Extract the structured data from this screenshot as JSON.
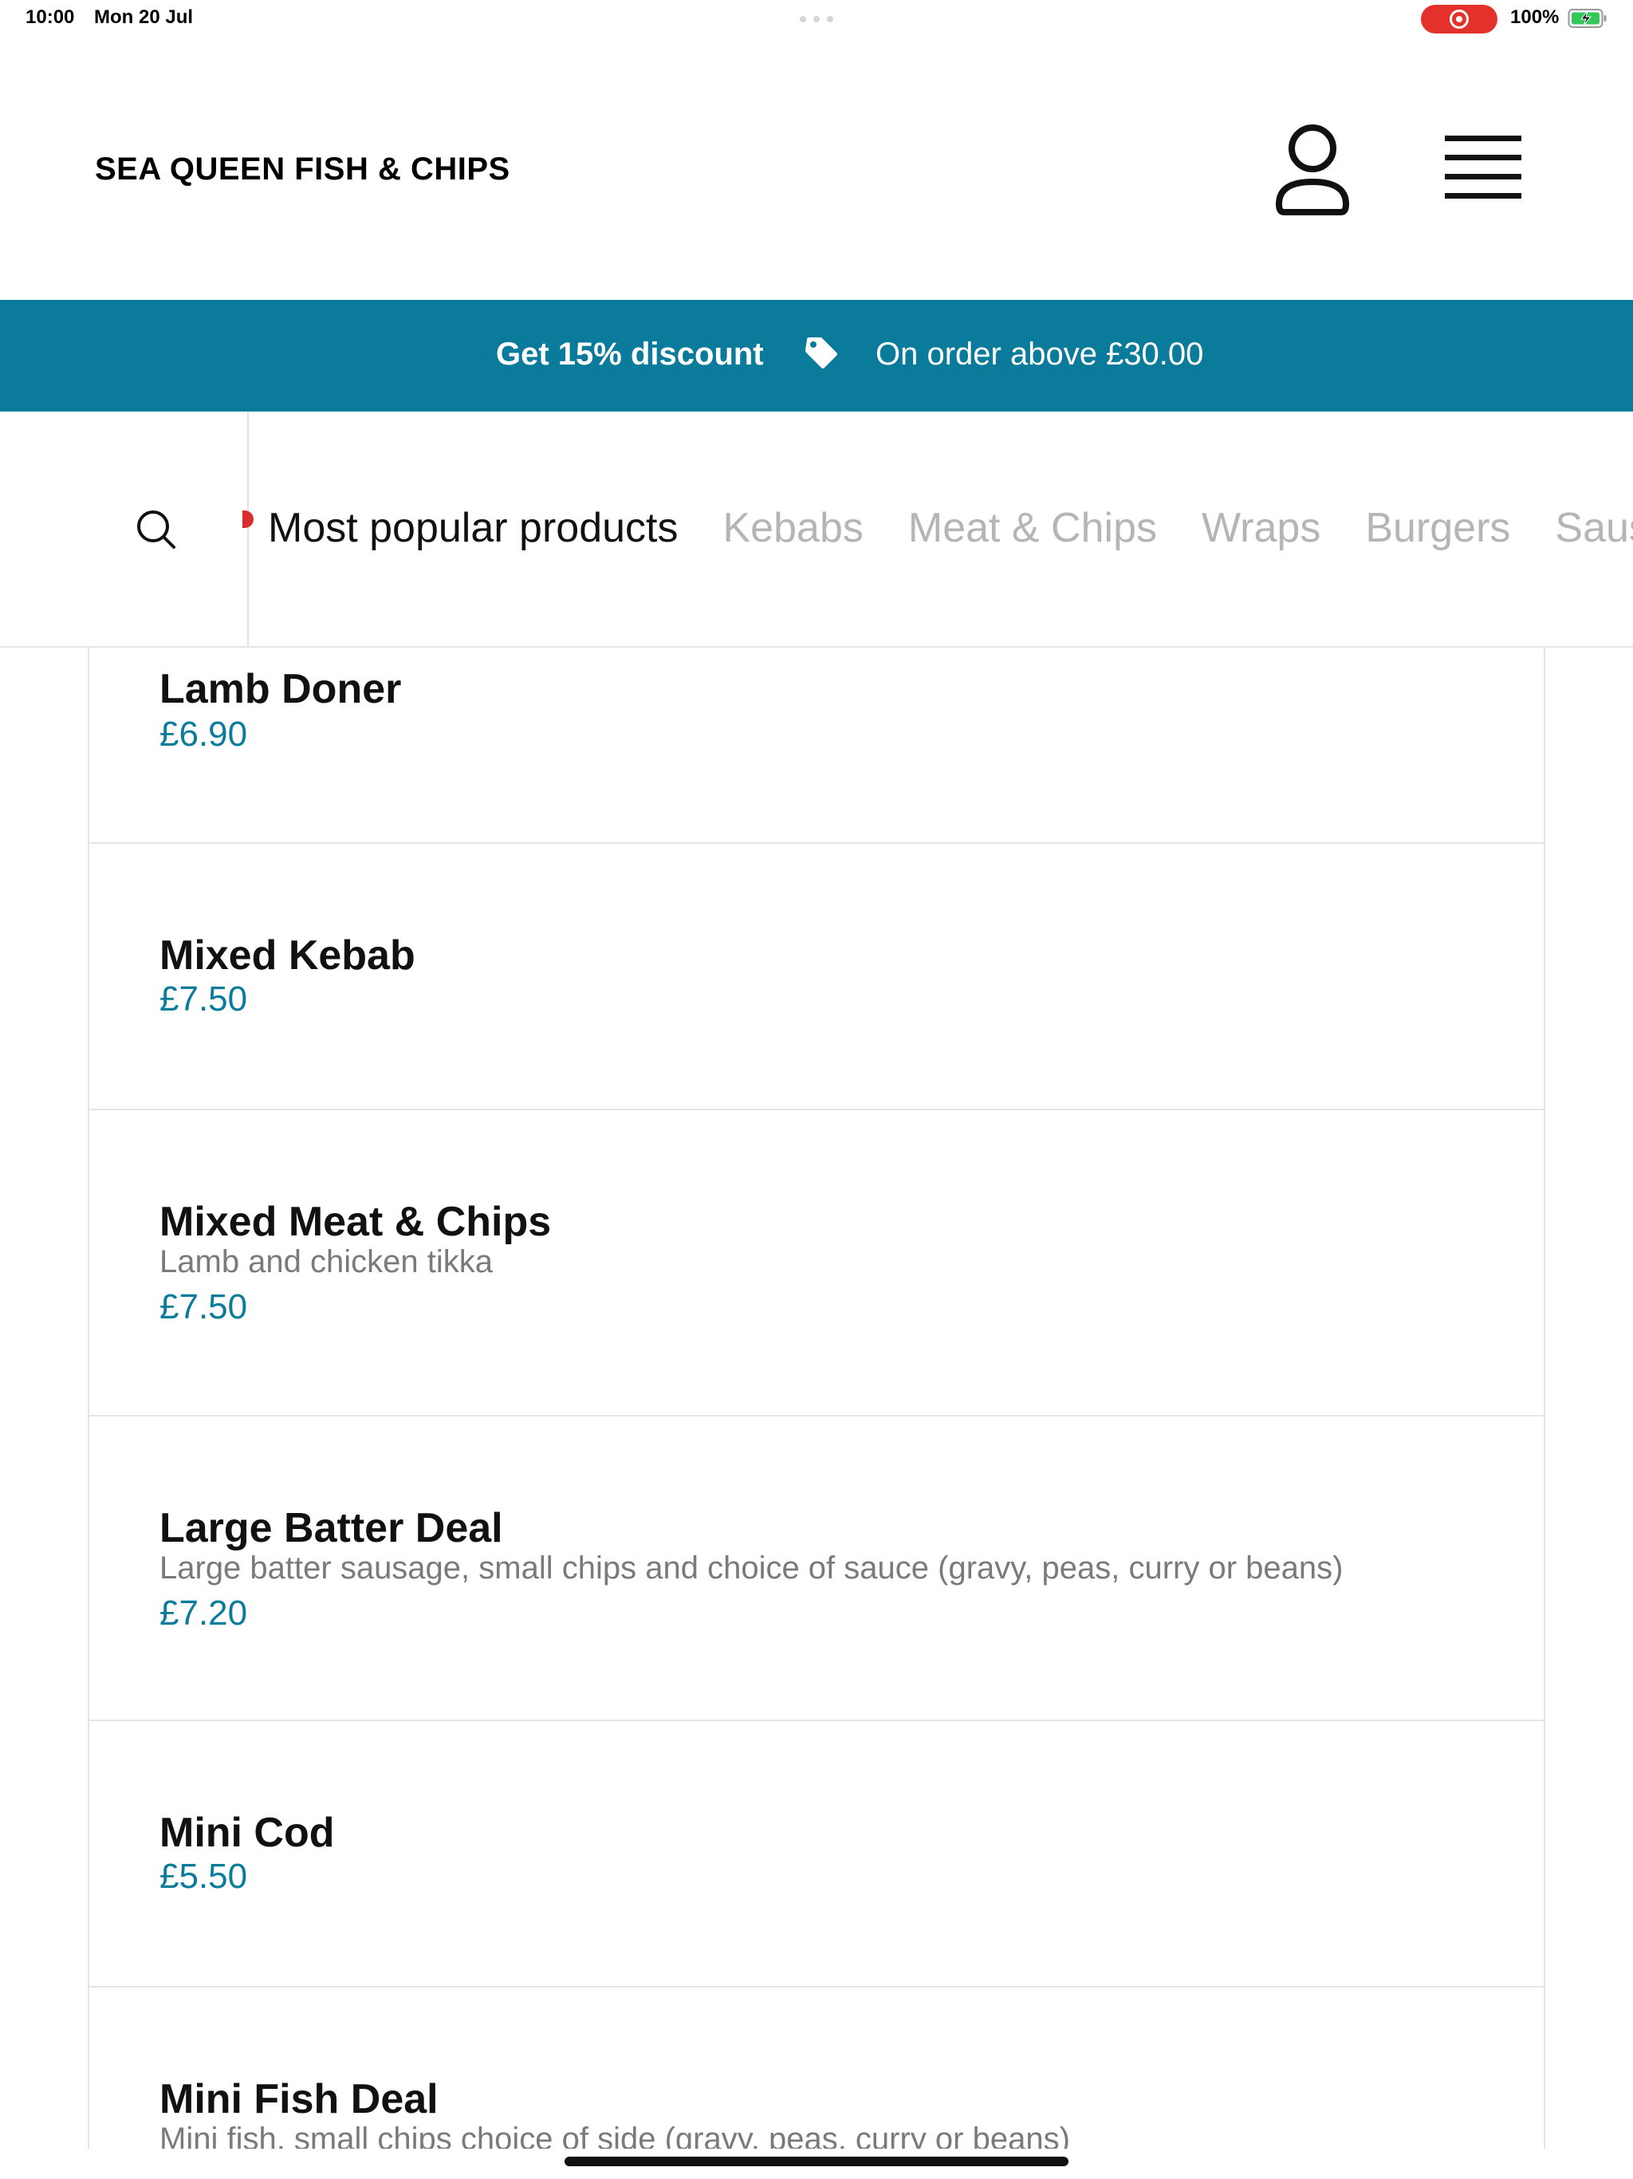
{
  "status_bar": {
    "time": "10:00",
    "date": "Mon 20 Jul",
    "battery": "100%"
  },
  "header": {
    "brand": "SEA QUEEN FISH & CHIPS",
    "icons": [
      "person-icon",
      "hamburger-menu-icon"
    ]
  },
  "promo": {
    "title": "Get 15% discount",
    "subtitle": "On order above £30.00",
    "background": "#0b7b9c",
    "icon": "price-tag-icon"
  },
  "categories": {
    "search_icon": "search-icon",
    "active_index": 0,
    "tabs": [
      "Most popular products",
      "Kebabs",
      "Meat & Chips",
      "Wraps",
      "Burgers",
      "Sausages"
    ]
  },
  "products": [
    {
      "name": "Lamb Doner",
      "description": "",
      "price": "£6.90"
    },
    {
      "name": "Mixed Kebab",
      "description": "",
      "price": "£7.50"
    },
    {
      "name": "Mixed Meat & Chips",
      "description": "Lamb and chicken tikka",
      "price": "£7.50"
    },
    {
      "name": "Large Batter Deal",
      "description": "Large batter sausage, small chips and choice of sauce (gravy, peas, curry or beans)",
      "price": "£7.20"
    },
    {
      "name": "Mini Cod",
      "description": "",
      "price": "£5.50"
    },
    {
      "name": "Mini Fish Deal",
      "description": "Mini fish, small chips choice of side (gravy, peas, curry or beans)",
      "price": ""
    }
  ],
  "colors": {
    "accent": "#0b7b9c",
    "record": "#e5312b",
    "inactive_tab": "#b5b5b5"
  }
}
